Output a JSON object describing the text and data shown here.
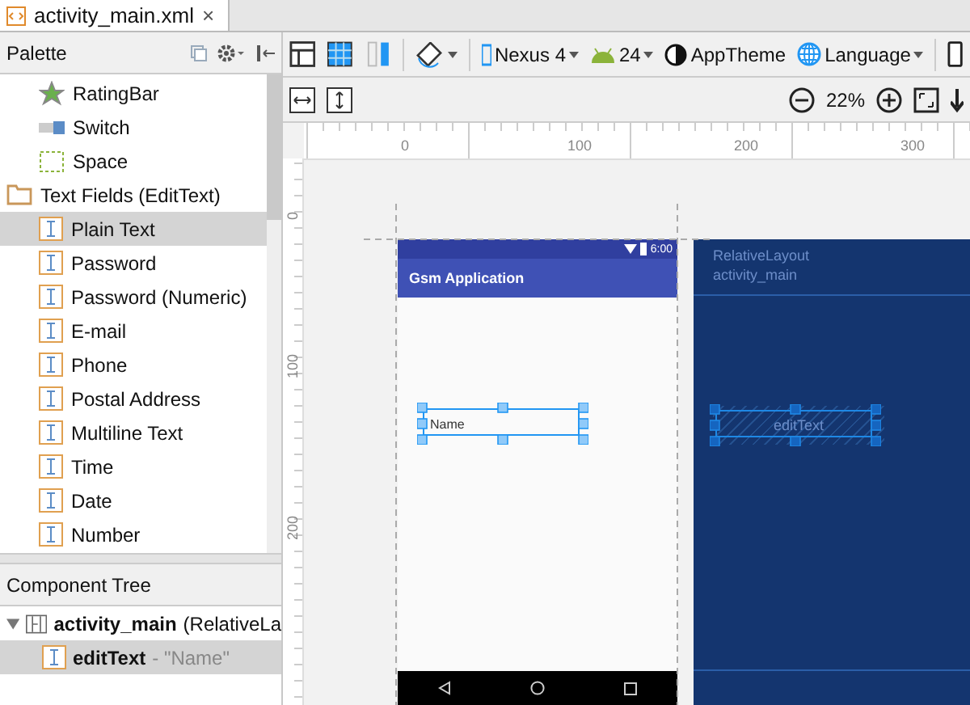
{
  "tab": {
    "title": "activity_main.xml",
    "close": "×"
  },
  "palette": {
    "title": "Palette",
    "items": [
      {
        "label": "RatingBar",
        "kind": "star",
        "selected": false
      },
      {
        "label": "Switch",
        "kind": "switch",
        "selected": false
      },
      {
        "label": "Space",
        "kind": "space",
        "selected": false
      },
      {
        "label": "Text Fields (EditText)",
        "kind": "folder",
        "selected": false,
        "children": [
          {
            "label": "Plain Text",
            "kind": "edittext",
            "selected": true
          },
          {
            "label": "Password",
            "kind": "edittext",
            "selected": false
          },
          {
            "label": "Password (Numeric)",
            "kind": "edittext",
            "selected": false
          },
          {
            "label": "E-mail",
            "kind": "edittext",
            "selected": false
          },
          {
            "label": "Phone",
            "kind": "edittext",
            "selected": false
          },
          {
            "label": "Postal Address",
            "kind": "edittext",
            "selected": false
          },
          {
            "label": "Multiline Text",
            "kind": "edittext",
            "selected": false
          },
          {
            "label": "Time",
            "kind": "edittext",
            "selected": false
          },
          {
            "label": "Date",
            "kind": "edittext",
            "selected": false
          },
          {
            "label": "Number",
            "kind": "edittext",
            "selected": false
          }
        ]
      }
    ]
  },
  "toolbar": {
    "device": "Nexus 4",
    "api": "24",
    "theme": "AppTheme",
    "language": "Language",
    "zoom": "22%"
  },
  "component_tree": {
    "title": "Component Tree",
    "nodes": [
      {
        "name": "activity_main",
        "detail": "(RelativeLa",
        "kind": "layout",
        "expanded": true,
        "selected": false,
        "children": [
          {
            "name": "editText",
            "detail": "- \"Name\"",
            "kind": "edittext",
            "selected": true
          }
        ]
      }
    ]
  },
  "rulers": {
    "horizontal": [
      "0",
      "100",
      "200",
      "300"
    ],
    "vertical": [
      "0",
      "100",
      "200"
    ]
  },
  "phone": {
    "time": "6:00",
    "app_title": "Gsm Application",
    "field_text": "Name"
  },
  "blueprint": {
    "layout_type": "RelativeLayout",
    "layout_id": "activity_main",
    "widget": "editText"
  }
}
